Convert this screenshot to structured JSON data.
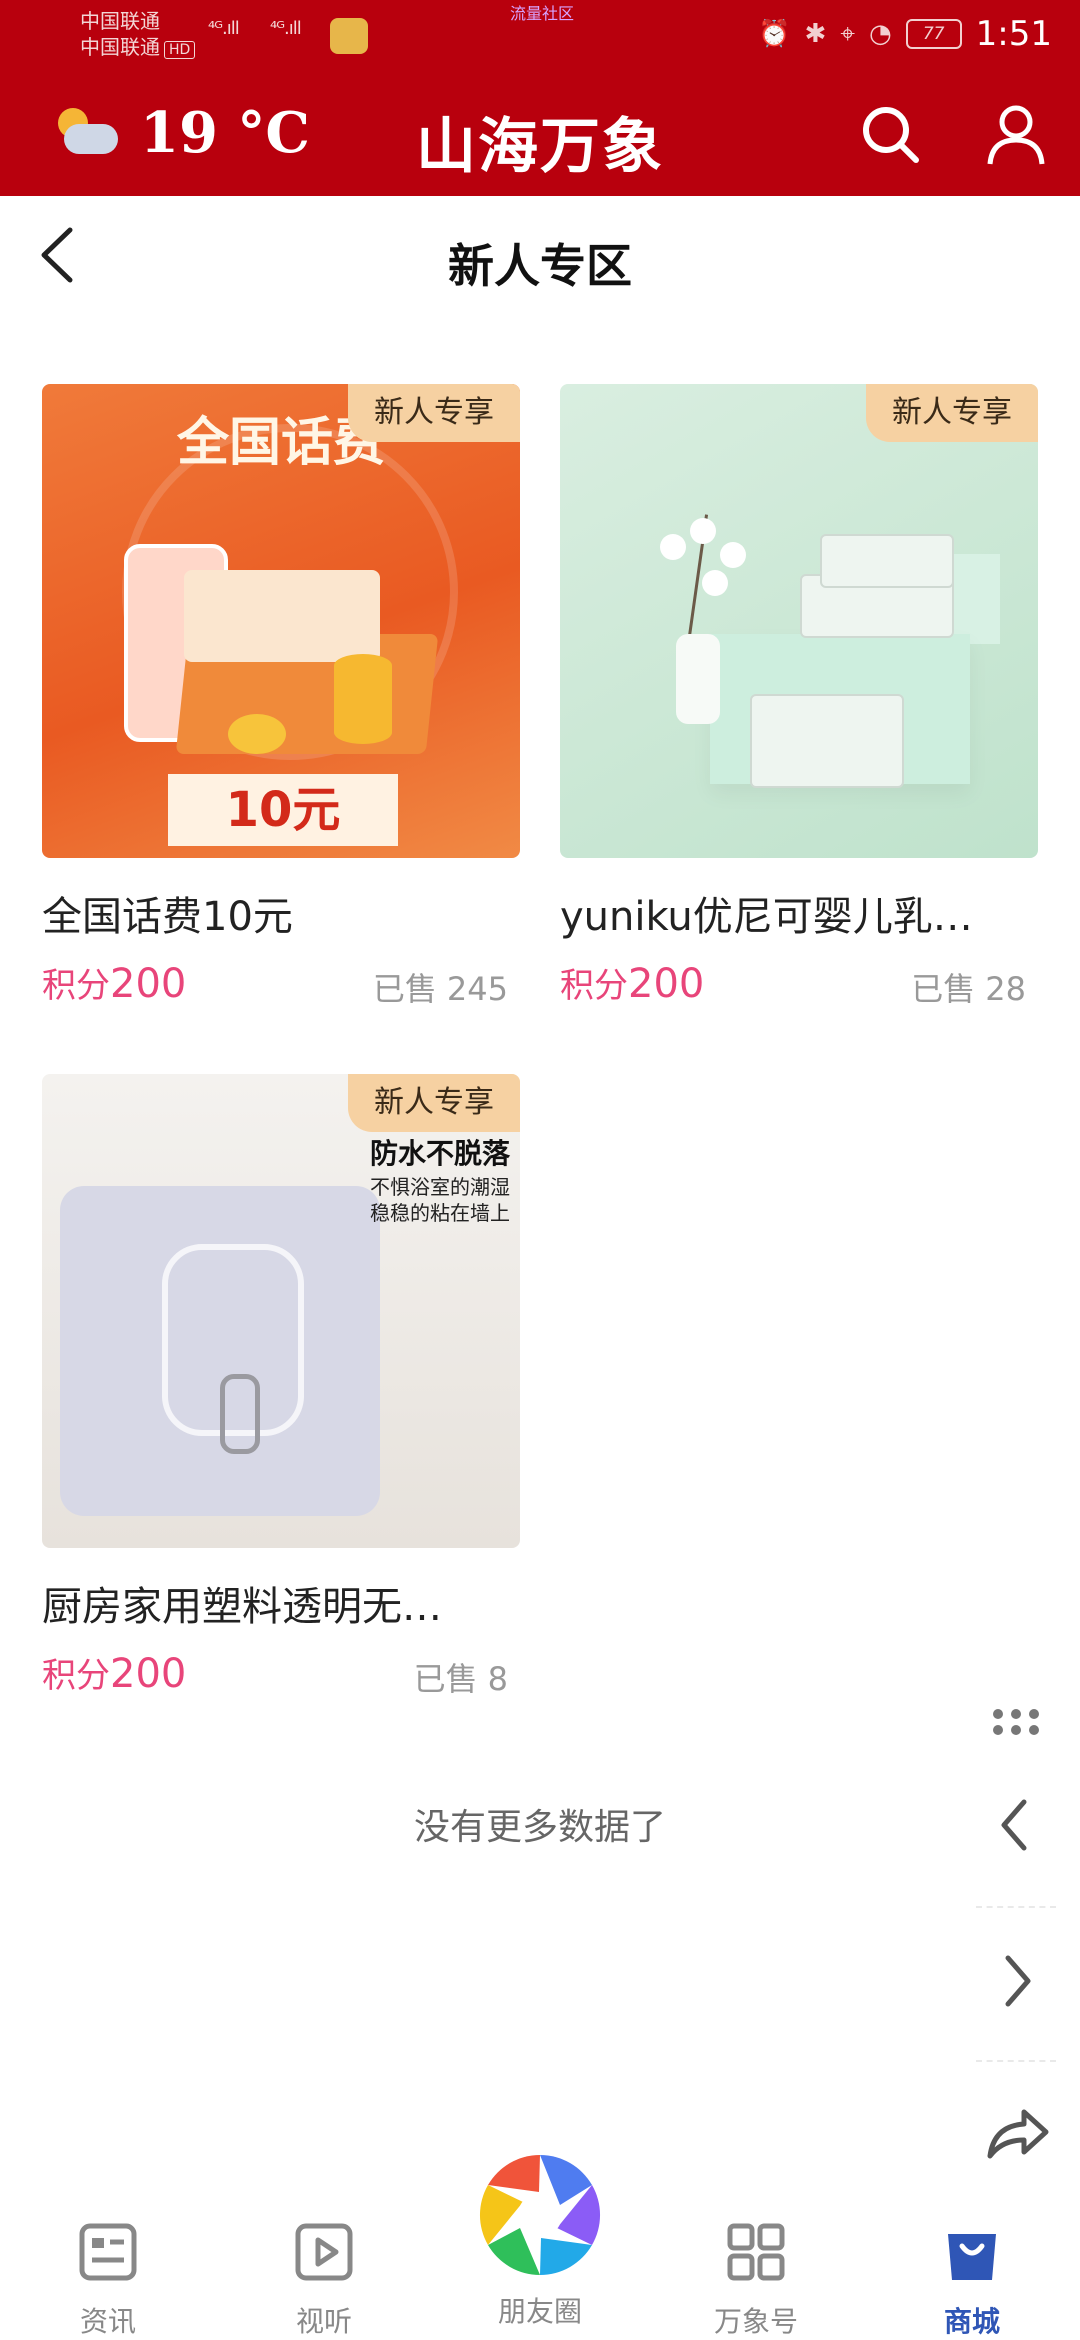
{
  "status_bar": {
    "carrier_1": "中国联通",
    "carrier_2": "中国联通",
    "hd_label": "HD",
    "signal_1": "⁴ᴳ.ıll",
    "signal_2": "⁴ᴳ.ıll",
    "center_text": "流量社区",
    "battery": "77",
    "time": "1:51"
  },
  "header": {
    "temperature": "19 °C",
    "app_title": "山海万象"
  },
  "page": {
    "title": "新人专区"
  },
  "products": [
    {
      "badge": "新人专享",
      "name": "全国话费10元",
      "price_label": "积分",
      "price_value": "200",
      "sold_label": "已售",
      "sold_value": "245",
      "image_headline": "全国话费",
      "image_price": "10元"
    },
    {
      "badge": "新人专享",
      "name": "yuniku优尼可婴儿乳…",
      "price_label": "积分",
      "price_value": "200",
      "sold_label": "已售",
      "sold_value": "28"
    },
    {
      "badge": "新人专享",
      "name": "厨房家用塑料透明无…",
      "price_label": "积分",
      "price_value": "200",
      "sold_label": "已售",
      "sold_value": "8",
      "image_title": "防水不脱落",
      "image_sub_1": "不惧浴室的潮湿",
      "image_sub_2": "稳稳的粘在墙上"
    }
  ],
  "list_end_text": "没有更多数据了",
  "tabs": [
    {
      "label": "资讯",
      "icon": "news-icon"
    },
    {
      "label": "视听",
      "icon": "play-icon"
    },
    {
      "label": "朋友圈",
      "icon": "camera-aperture-icon"
    },
    {
      "label": "万象号",
      "icon": "grid-icon"
    },
    {
      "label": "商城",
      "icon": "shopping-bag-icon",
      "active": true
    }
  ],
  "colors": {
    "header_red": "#b8000d",
    "price_pink": "#e8457a",
    "badge_bg": "#f6d1a2",
    "active_tab": "#2f56b6"
  }
}
